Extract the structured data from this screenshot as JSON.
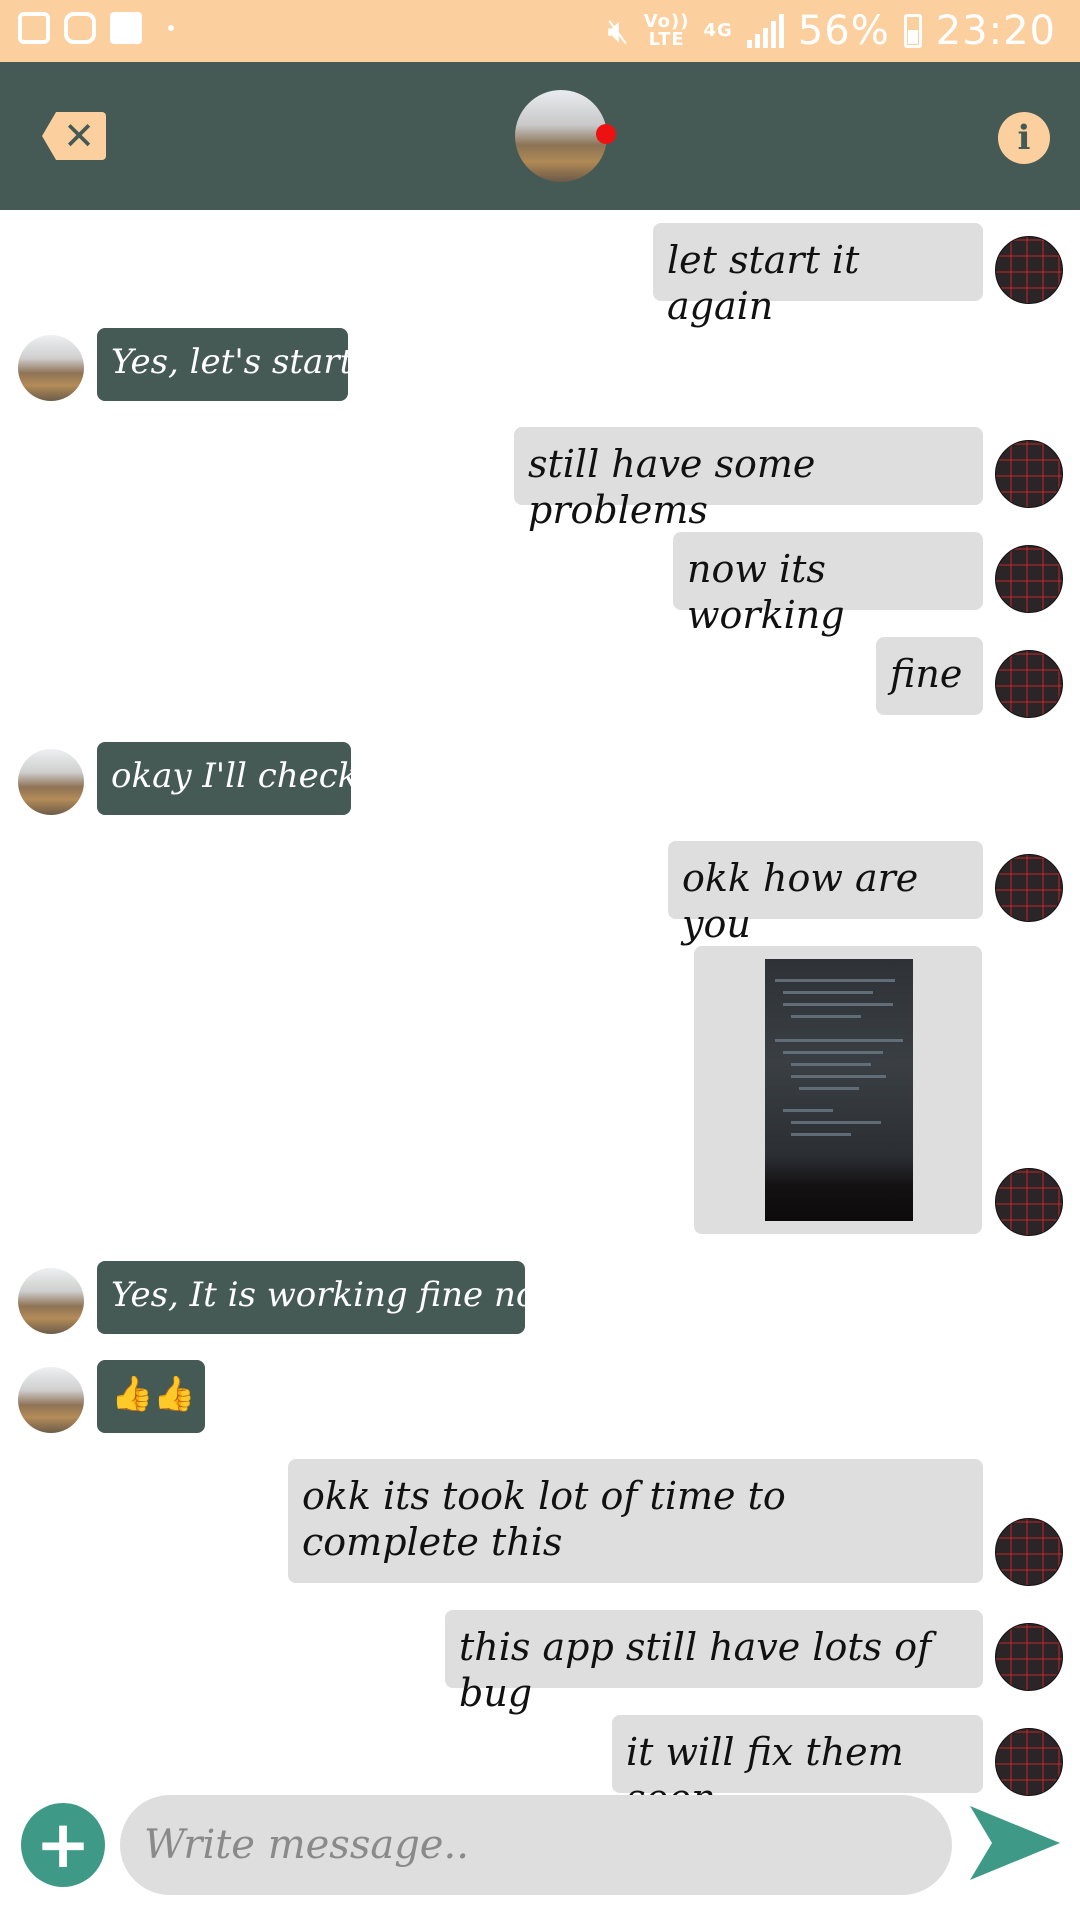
{
  "status_bar": {
    "network_top": "Vo))",
    "network_bottom": "LTE",
    "data_type": "4G",
    "battery": "56%",
    "time": "23:20"
  },
  "header": {
    "close_icon": "close-icon",
    "info_label": "i",
    "online_status_color": "#ee1111"
  },
  "messages": [
    {
      "direction": "out",
      "text": "let start it again"
    },
    {
      "direction": "in",
      "text": "Yes, let's start"
    },
    {
      "direction": "out",
      "text": "still have some problems"
    },
    {
      "direction": "out",
      "text": "now its working"
    },
    {
      "direction": "out",
      "text": "fine"
    },
    {
      "direction": "in",
      "text": "okay I'll check"
    },
    {
      "direction": "out",
      "text": "okk how are you"
    },
    {
      "direction": "out",
      "type": "image"
    },
    {
      "direction": "in",
      "text": "Yes, It is working fine now"
    },
    {
      "direction": "in",
      "text": "👍👍"
    },
    {
      "direction": "out",
      "text": "okk its took lot of time to complete this"
    },
    {
      "direction": "out",
      "text": "this app still have lots of bug"
    },
    {
      "direction": "out",
      "text": "it will fix them soon"
    }
  ],
  "composer": {
    "placeholder": "Write message..",
    "add_icon": "plus-icon",
    "send_icon": "send-icon"
  },
  "colors": {
    "accent": "#fccf9e",
    "header": "#455a55",
    "outgoing_bubble": "#dedede",
    "incoming_bubble": "#455a55",
    "send": "#3e9a87"
  }
}
